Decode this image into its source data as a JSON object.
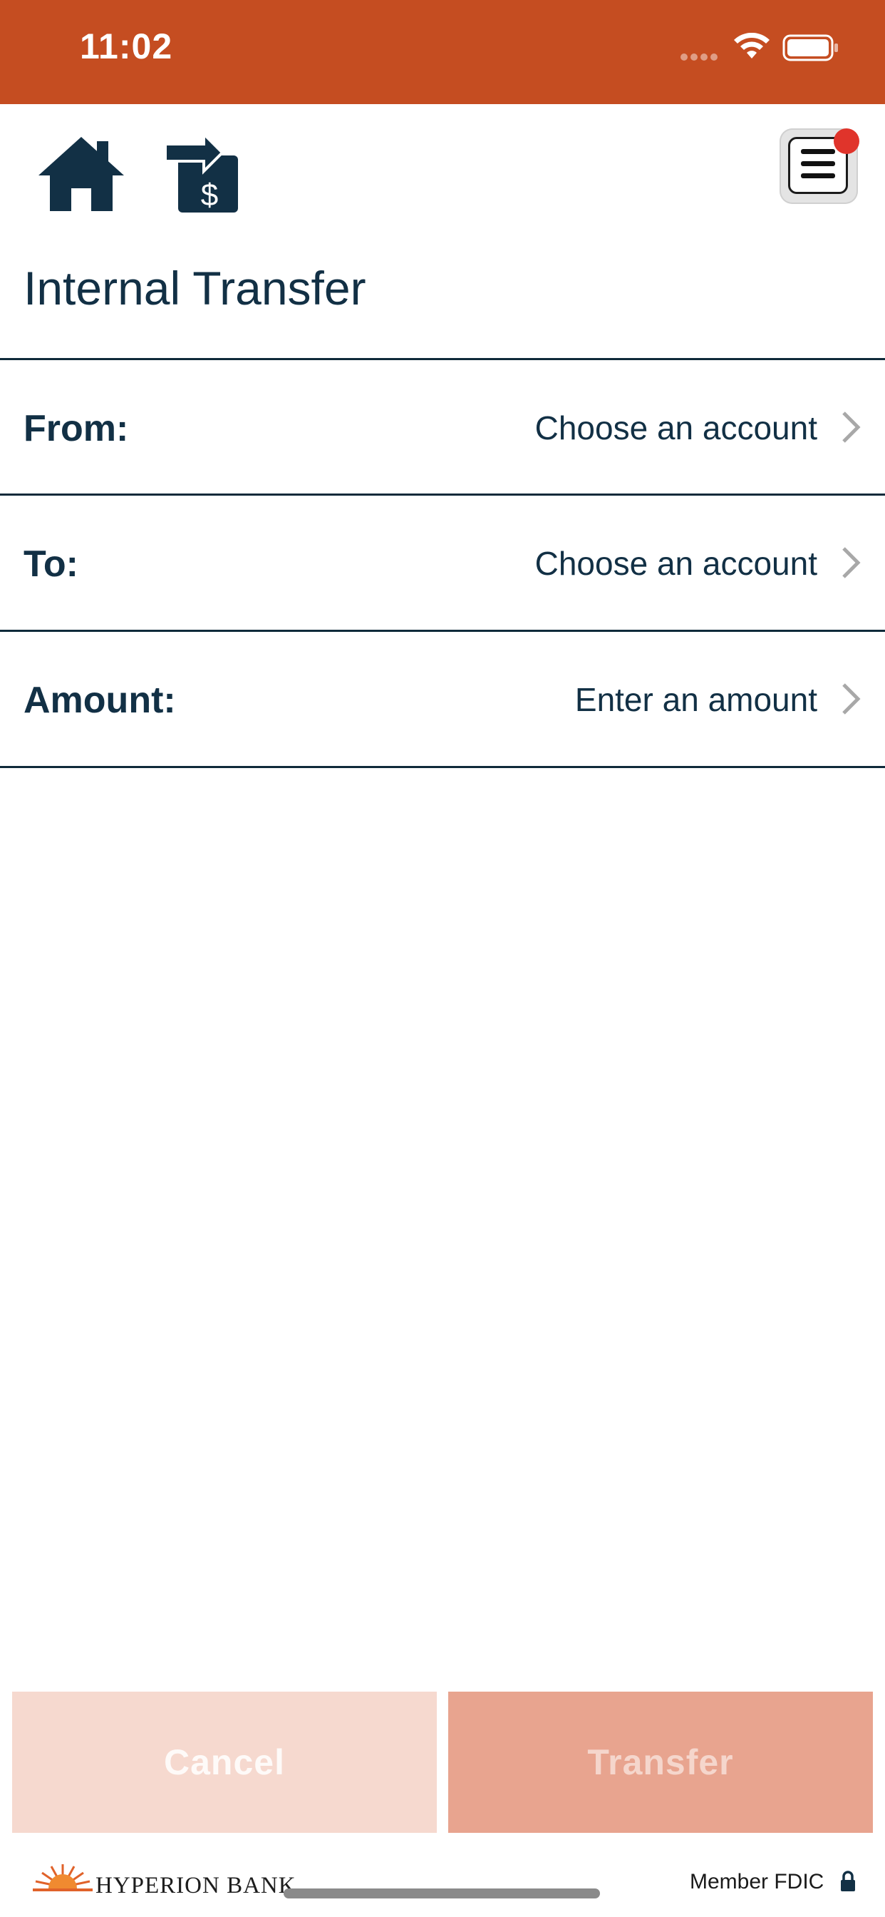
{
  "status_bar": {
    "time": "11:02",
    "background_color": "#c54d21",
    "icons": [
      "signal-dots-icon",
      "wifi-icon",
      "battery-icon"
    ]
  },
  "header": {
    "icons": [
      "home-icon",
      "transfer-money-icon",
      "menu-icon"
    ],
    "notification_badge": true
  },
  "page": {
    "title": "Internal Transfer"
  },
  "form": {
    "rows": [
      {
        "label": "From:",
        "value": "Choose an account"
      },
      {
        "label": "To:",
        "value": "Choose an account"
      },
      {
        "label": "Amount:",
        "value": "Enter an amount"
      }
    ]
  },
  "actions": {
    "cancel_label": "Cancel",
    "transfer_label": "Transfer",
    "cancel_color": "#f6d9cf",
    "transfer_color": "#e8a48f"
  },
  "footer": {
    "bank_name": "HYPERION BANK",
    "fdic_text": "Member FDIC",
    "icons": [
      "sunrise-logo-icon",
      "lock-icon"
    ]
  }
}
